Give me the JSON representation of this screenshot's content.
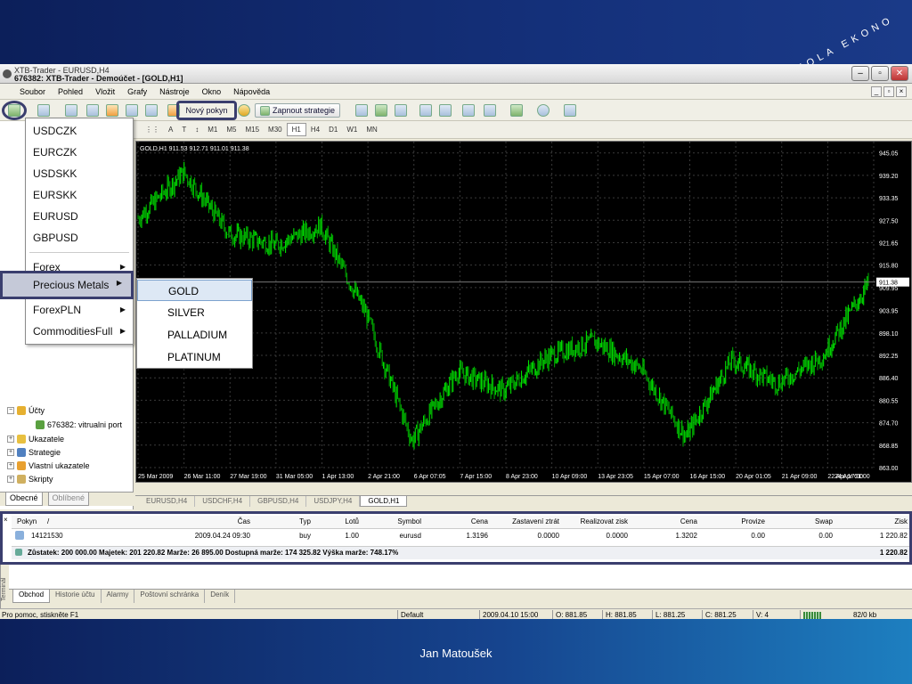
{
  "slide": {
    "author": "Jan Matoušek",
    "logo_text": "ŠKOLA EKONO"
  },
  "window": {
    "title_back": "XTB-Trader - EURUSD,H4",
    "title": "676382: XTB-Trader - Demoúčet - [GOLD,H1]",
    "buttons": [
      "‒",
      "▫",
      "✕"
    ]
  },
  "menubar": [
    "Soubor",
    "Pohled",
    "Vložit",
    "Grafy",
    "Nástroje",
    "Okno",
    "Nápověda"
  ],
  "toolbar": {
    "new_order": "Nový pokyn",
    "enable_strategies": "Zapnout strategie"
  },
  "timeframes": [
    "A",
    "T",
    "M1",
    "M5",
    "M15",
    "M30",
    "H1",
    "H4",
    "D1",
    "W1",
    "MN"
  ],
  "active_timeframe": "H1",
  "symbols_menu": {
    "items": [
      "USDCZK",
      "EURCZK",
      "USDSKK",
      "EURSKK",
      "EURUSD",
      "GBPUSD"
    ],
    "groups": [
      "Forex",
      "Precious Metals",
      "ForexPLN",
      "CommoditiesFull"
    ],
    "highlighted_group": "Precious Metals",
    "submenu": [
      "GOLD",
      "SILVER",
      "PALLADIUM",
      "PLATINUM"
    ],
    "selected": "GOLD"
  },
  "navigator": {
    "accounts": "Účty",
    "account": "676382: vitrualni port",
    "indicators": "Ukazatele",
    "strategies": "Strategie",
    "custom_indicators": "Vlastní ukazatele",
    "scripts": "Skripty",
    "tabs": [
      "Obecné",
      "Oblíbené"
    ]
  },
  "chart": {
    "info": "GOLD,H1  911.53 912.71 911.01 911.38",
    "current_price": "911.38",
    "price_labels": [
      "945.05",
      "939.20",
      "933.35",
      "927.50",
      "921.65",
      "915.80",
      "909.95",
      "903.95",
      "898.10",
      "892.25",
      "886.40",
      "880.55",
      "874.70",
      "868.85",
      "863.00"
    ],
    "time_labels": [
      "25 Mar 2009",
      "26 Mar 11:00",
      "27 Mar 19:00",
      "31 Mar 05:00",
      "1 Apr 13:00",
      "2 Apr 21:00",
      "6 Apr 07:05",
      "7 Apr 15:00",
      "8 Apr 23:00",
      "10 Apr 09:00",
      "13 Apr 23:05",
      "15 Apr 07:00",
      "16 Apr 15:00",
      "20 Apr 01:05",
      "21 Apr 09:00",
      "22 Apr 17:00",
      "24 Apr 01:00"
    ],
    "tabs": [
      "EURUSD,H4",
      "USDCHF,H4",
      "GBPUSD,H4",
      "USDJPY,H4",
      "GOLD,H1"
    ],
    "active_tab": "GOLD,H1",
    "bull_color": "#00e000",
    "bear_color": "#00a000",
    "grid_color": "#3a3a3a"
  },
  "chart_data": {
    "type": "line",
    "title": "GOLD,H1",
    "ylim": [
      863.0,
      948.0
    ],
    "x": [
      "25 Mar 2009",
      "26 Mar 11:00",
      "27 Mar 19:00",
      "31 Mar 05:00",
      "1 Apr 13:00",
      "2 Apr 21:00",
      "6 Apr 07:05",
      "7 Apr 15:00",
      "8 Apr 23:00",
      "10 Apr 09:00",
      "13 Apr 23:05",
      "15 Apr 07:00",
      "16 Apr 15:00",
      "20 Apr 01:05",
      "21 Apr 09:00",
      "22 Apr 17:00",
      "24 Apr 01:00"
    ],
    "series": [
      {
        "values": [
          928,
          940,
          924,
          921,
          926,
          903,
          870,
          888,
          883,
          892,
          896,
          889,
          871,
          891,
          885,
          892,
          911
        ]
      }
    ],
    "grid": true
  },
  "terminal": {
    "headers": [
      "Pokyn",
      "/",
      "Čas",
      "Typ",
      "Lotů",
      "Symbol",
      "Cena",
      "Zastavení ztrát",
      "Realizovat zisk",
      "Cena",
      "Provize",
      "Swap",
      "Zisk"
    ],
    "row": [
      "14121530",
      "2009.04.24 09:30",
      "buy",
      "1.00",
      "eurusd",
      "1.3196",
      "0.0000",
      "0.0000",
      "1.3202",
      "0.00",
      "0.00",
      "1 220.82"
    ],
    "summary": "Zůstatek: 200 000.00  Majetek: 201 220.82  Marže: 26 895.00  Dostupná marže: 174 325.82  Výška marže: 748.17%",
    "summary_profit": "1 220.82",
    "side_label": "Terminál",
    "tabs": [
      "Obchod",
      "Historie účtu",
      "Alarmy",
      "Poštovní schránka",
      "Deník"
    ]
  },
  "statusbar": {
    "help": "Pro pomoc, stiskněte F1",
    "profile": "Default",
    "datetime": "2009.04.10 15:00",
    "open": "O: 881.85",
    "high": "H: 881.85",
    "low": "L: 881.25",
    "close": "C: 881.25",
    "volume": "V: 4",
    "traffic": "82/0 kb"
  }
}
